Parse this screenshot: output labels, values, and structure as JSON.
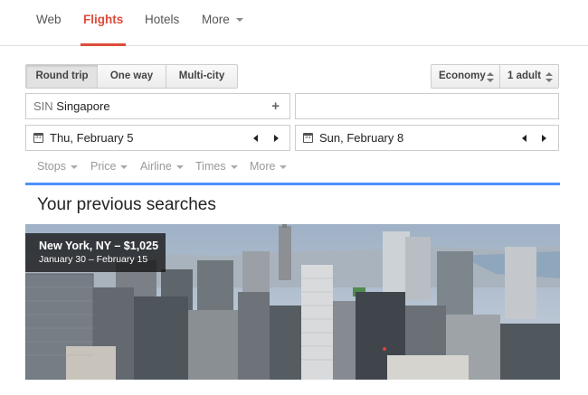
{
  "nav": {
    "tabs": [
      {
        "label": "Web"
      },
      {
        "label": "Flights",
        "active": true
      },
      {
        "label": "Hotels"
      },
      {
        "label": "More"
      }
    ]
  },
  "trip_type": {
    "options": [
      "Round trip",
      "One way",
      "Multi-city"
    ],
    "selected": "Round trip"
  },
  "cabin_class": {
    "value": "Economy"
  },
  "passengers": {
    "value": "1 adult"
  },
  "origin": {
    "code": "SIN",
    "city": "Singapore"
  },
  "destination": {
    "value": ""
  },
  "depart": {
    "value": "Thu, February 5"
  },
  "return_date": {
    "value": "Sun, February 8"
  },
  "calendar_icon_text": "31",
  "filters": [
    "Stops",
    "Price",
    "Airline",
    "Times",
    "More"
  ],
  "previous_searches": {
    "title": "Your previous searches",
    "items": [
      {
        "title": "New York, NY – $1,025",
        "dates": "January 30 – February 15"
      }
    ]
  },
  "colors": {
    "accent": "#dd4b39",
    "divider": "#4d90fe"
  },
  "icons": [
    "plus-icon",
    "calendar-icon",
    "prev-arrow-icon",
    "next-arrow-icon",
    "caret-down-icon",
    "updown-icon"
  ]
}
